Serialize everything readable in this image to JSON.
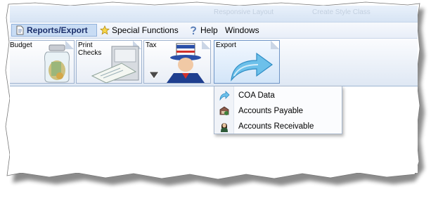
{
  "faded_toolbar": {
    "item_1": "Responsive Layout",
    "item_2": "Create Style Class"
  },
  "menubar": {
    "items": [
      {
        "label": "Reports/Export",
        "icon": "report-page-icon",
        "active": true
      },
      {
        "label": "Special Functions",
        "icon": "star-icon",
        "active": false
      },
      {
        "label": "Help",
        "icon": "question-icon",
        "active": false
      },
      {
        "label": "Windows",
        "icon": "",
        "active": false
      }
    ]
  },
  "toolbar": {
    "tiles": [
      {
        "label": "Budget",
        "icon": "money-jar-icon"
      },
      {
        "label": "Print Checks",
        "icon": "check-printer-icon"
      },
      {
        "label": "Tax",
        "icon": "uncle-sam-icon"
      },
      {
        "label": "Export",
        "icon": "export-arrow-icon"
      }
    ]
  },
  "export_menu": {
    "items": [
      {
        "label": "COA Data",
        "icon": "export-arrow-icon"
      },
      {
        "label": "Accounts Payable",
        "icon": "payable-icon"
      },
      {
        "label": "Accounts Receivable",
        "icon": "receivable-person-icon"
      }
    ]
  },
  "colors": {
    "menu_active_bg": "#c8dcf4",
    "menu_active_text": "#1b2f6b",
    "toolbar_border": "#9fb6d3",
    "export_arrow": "#5bb0e3"
  }
}
